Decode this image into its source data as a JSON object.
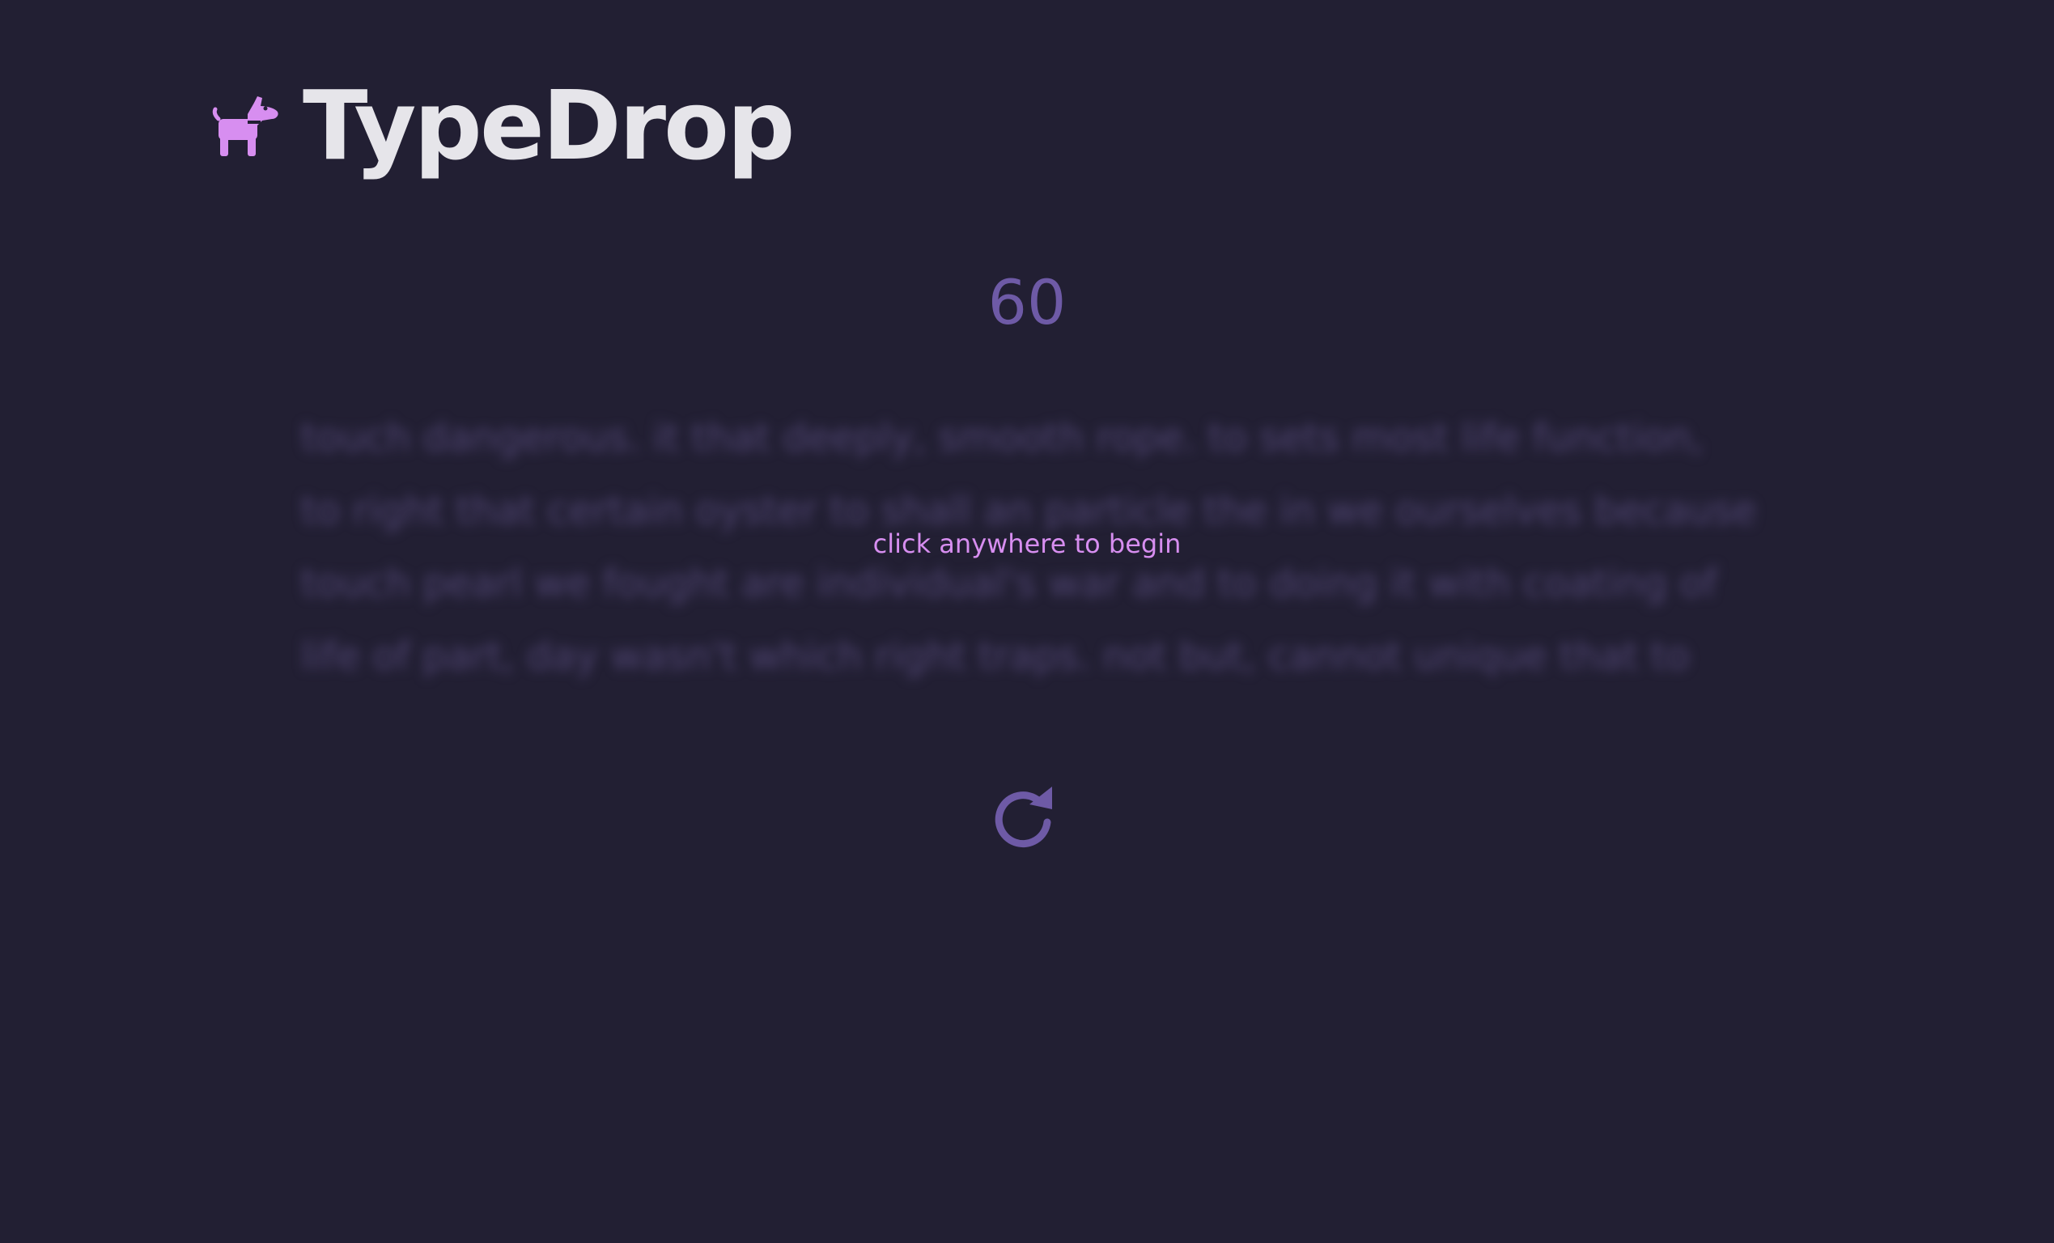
{
  "app": {
    "name": "TypeDrop",
    "logo_icon": "dog-icon",
    "accent_color": "#d78ef0",
    "muted_color": "#6e5aa6"
  },
  "timer": {
    "value": "60"
  },
  "typing_test": {
    "lines": [
      "touch dangerous. it that deeply, smooth rope. to sets most life function,",
      "to right that certain oyster to shall an particle the in we ourselves because",
      "touch pearl we fought are individual's war and to doing it with coating of",
      "life of part, day wasn't which right traps. not but, cannot unique that to"
    ],
    "overlay_message": "click anywhere to begin"
  },
  "controls": {
    "restart_icon": "restart-icon"
  }
}
